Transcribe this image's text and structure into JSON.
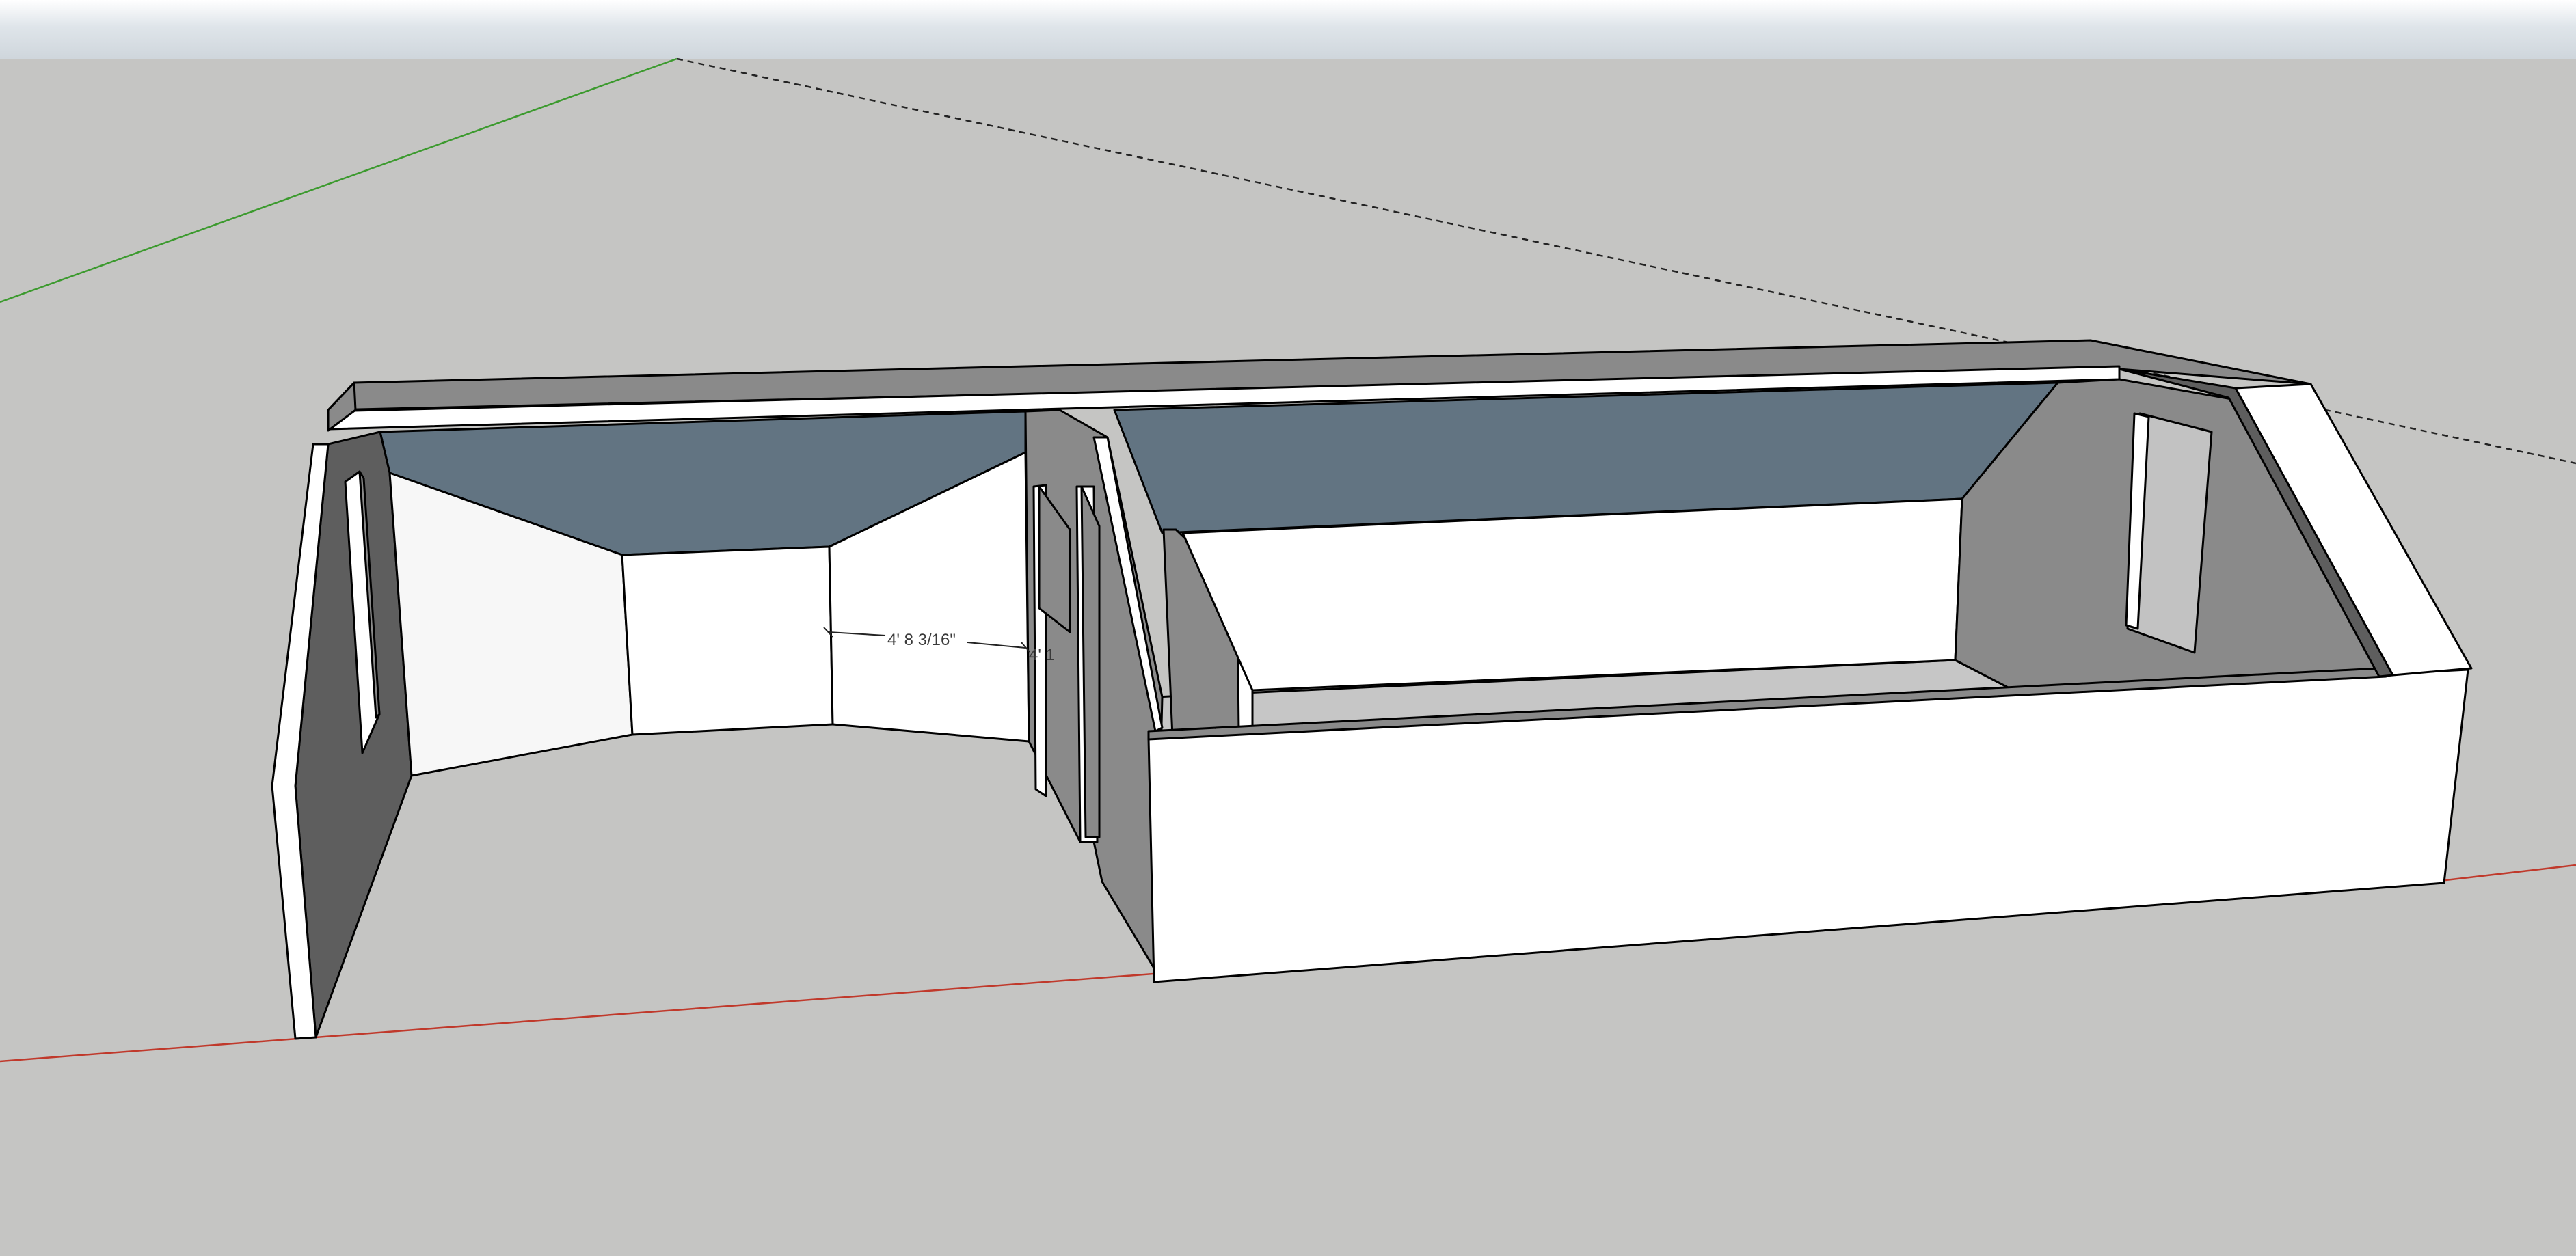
{
  "viewport": {
    "sky_color": "#dfe5ea",
    "ground_color": "#c5c5c3",
    "axis_colors": {
      "red_axis": "#c0392b",
      "green_axis": "#3c9a2e",
      "inference_line": "#222222"
    }
  },
  "model": {
    "colors": {
      "face_front": "#ffffff",
      "face_back": "#f7f7f7",
      "face_shaded": "#8a8a8a",
      "face_dark": "#5e5e5e",
      "ceiling": "#627482",
      "floor": "#c6c6c6",
      "edge": "#000000"
    }
  },
  "dimensions": {
    "primary": "4' 8 3/16\"",
    "secondary": "4' 1"
  }
}
